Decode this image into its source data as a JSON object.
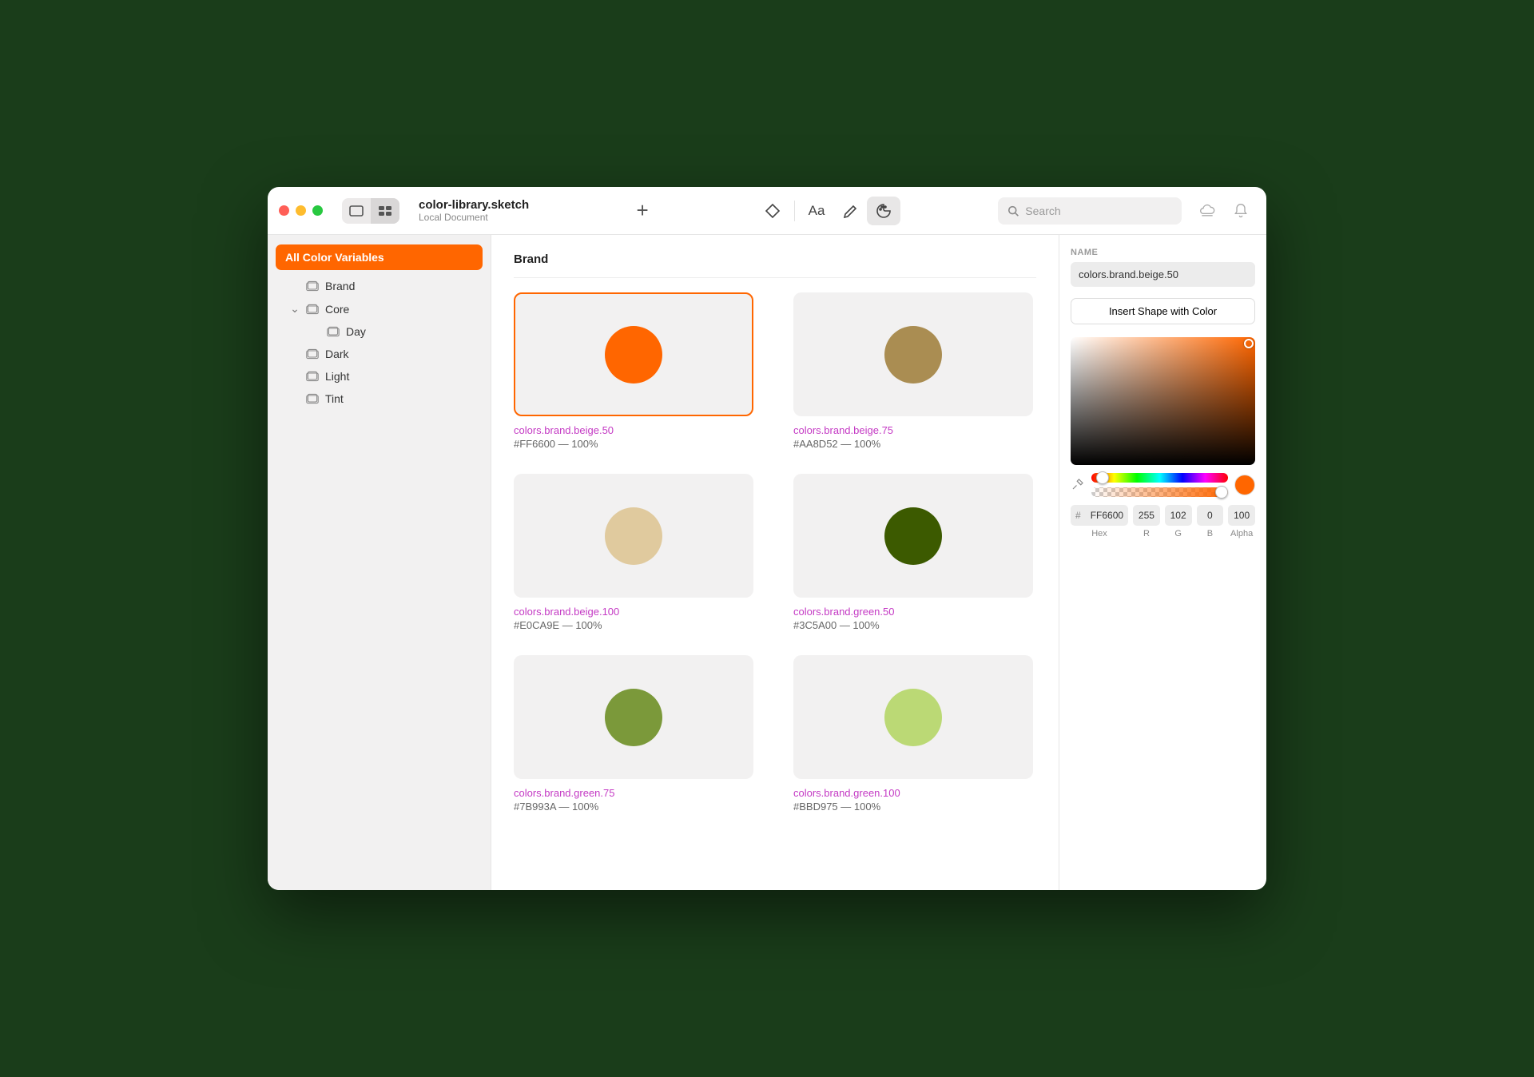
{
  "header": {
    "title": "color-library.sketch",
    "subtitle": "Local Document"
  },
  "search": {
    "placeholder": "Search"
  },
  "sidebar": {
    "group_label": "All Color Variables",
    "items": [
      {
        "label": "Brand"
      },
      {
        "label": "Core"
      },
      {
        "label": "Day",
        "sub": true
      },
      {
        "label": "Dark"
      },
      {
        "label": "Light"
      },
      {
        "label": "Tint"
      }
    ]
  },
  "main": {
    "section_title": "Brand",
    "cards": [
      {
        "name": "colors.brand.beige.50",
        "hex": "#FF6600",
        "opacity": "100%",
        "color": "#FF6600",
        "selected": true
      },
      {
        "name": "colors.brand.beige.75",
        "hex": "#AA8D52",
        "opacity": "100%",
        "color": "#AA8D52"
      },
      {
        "name": "colors.brand.beige.100",
        "hex": "#E0CA9E",
        "opacity": "100%",
        "color": "#E0CA9E"
      },
      {
        "name": "colors.brand.green.50",
        "hex": "#3C5A00",
        "opacity": "100%",
        "color": "#3C5A00"
      },
      {
        "name": "colors.brand.green.75",
        "hex": "#7B993A",
        "opacity": "100%",
        "color": "#7B993A"
      },
      {
        "name": "colors.brand.green.100",
        "hex": "#BBD975",
        "opacity": "100%",
        "color": "#BBD975"
      }
    ]
  },
  "inspector": {
    "name_label": "NAME",
    "name_value": "colors.brand.beige.50",
    "insert_button": "Insert Shape with Color",
    "hex": "FF6600",
    "r": "255",
    "g": "102",
    "b": "0",
    "alpha": "100",
    "labels": {
      "hex": "Hex",
      "r": "R",
      "g": "G",
      "b": "B",
      "alpha": "Alpha"
    }
  }
}
